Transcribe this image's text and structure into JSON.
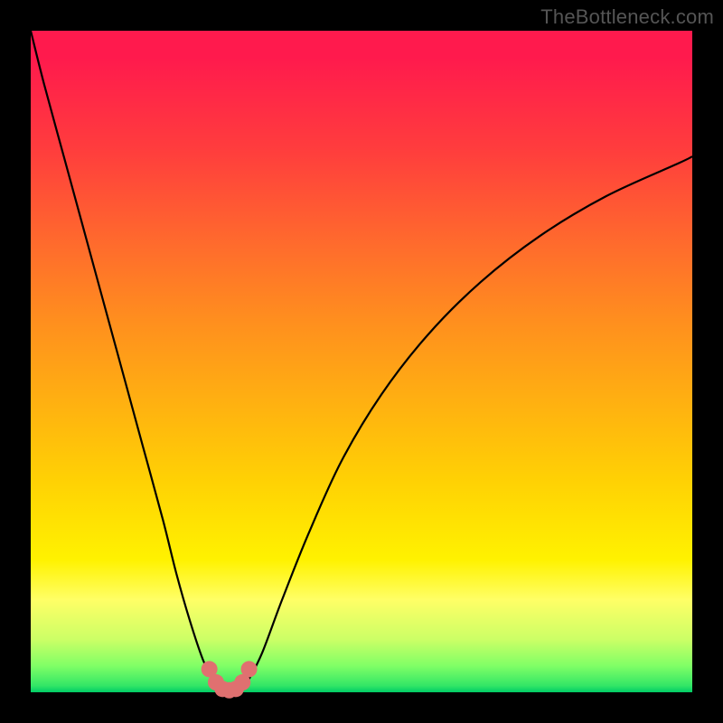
{
  "watermark": "TheBottleneck.com",
  "colors": {
    "frame": "#000000",
    "curve": "#000000",
    "marker_fill": "#e07070",
    "marker_stroke": "#c05050"
  },
  "chart_data": {
    "type": "line",
    "title": "",
    "xlabel": "",
    "ylabel": "",
    "xlim": [
      0,
      100
    ],
    "ylim": [
      0,
      100
    ],
    "grid": false,
    "series": [
      {
        "name": "bottleneck-curve",
        "x": [
          0,
          2,
          5,
          8,
          11,
          14,
          17,
          20,
          22,
          24,
          26,
          27.5,
          29,
          30,
          31,
          32,
          33,
          35,
          38,
          42,
          47,
          53,
          60,
          68,
          77,
          87,
          98,
          100
        ],
        "y": [
          100,
          92,
          81,
          70,
          59,
          48,
          37,
          26,
          18,
          11,
          5,
          2,
          0.5,
          0,
          0,
          0.5,
          2,
          6,
          14,
          24,
          35,
          45,
          54,
          62,
          69,
          75,
          80,
          81
        ]
      }
    ],
    "markers": {
      "name": "highlight-points",
      "x": [
        27,
        28,
        29,
        30,
        31,
        32,
        33
      ],
      "y": [
        3.5,
        1.5,
        0.5,
        0.3,
        0.5,
        1.5,
        3.5
      ]
    },
    "background_gradient": {
      "top": "#ff1a4d",
      "bottom": "#00cc66"
    }
  }
}
